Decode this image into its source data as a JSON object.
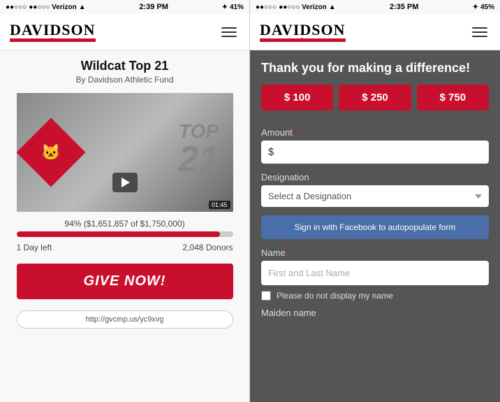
{
  "left": {
    "status_bar": {
      "carrier": "●●○○○ Verizon",
      "wifi": "WiFi",
      "time": "2:39 PM",
      "battery": "41%"
    },
    "logo": "DAVIDSON",
    "campaign_title": "Wildcat Top 21",
    "campaign_subtitle": "By Davidson Athletic Fund",
    "video": {
      "duration": "01:45"
    },
    "progress": {
      "percent": "94%",
      "raised": "$1,651,857",
      "goal": "$1,750,000",
      "text": "94% ($1,651,857 of $1,750,000)",
      "bar_width": "94%"
    },
    "days_left": "1 Day left",
    "donors": "2,048 Donors",
    "give_now_label": "GIVE NOW!",
    "url": "http://gvcmp.us/yc9xvg"
  },
  "right": {
    "status_bar": {
      "carrier": "●●○○○ Verizon",
      "wifi": "WiFi",
      "time": "2:35 PM",
      "battery": "45%"
    },
    "logo": "DAVIDSON",
    "heading": "Thank you for making a difference!",
    "amount_buttons": [
      {
        "label": "$ 100"
      },
      {
        "label": "$ 250"
      },
      {
        "label": "$ 750"
      }
    ],
    "amount_label": "Amount",
    "amount_placeholder": "$",
    "designation_label": "Designation",
    "designation_placeholder": "Select a Designation",
    "facebook_btn": "Sign in with Facebook to autopopulate form",
    "name_label": "Name",
    "name_placeholder": "First and Last Name",
    "no_display_label": "Please do not display my name",
    "maiden_label": "Maiden name"
  }
}
